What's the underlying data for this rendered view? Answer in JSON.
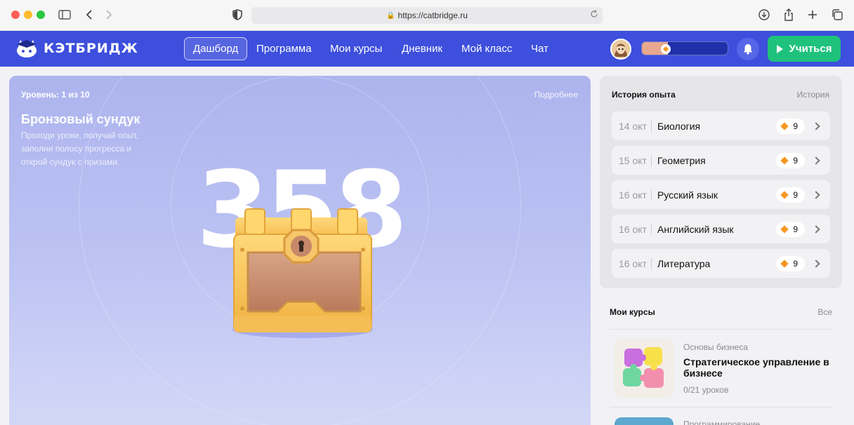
{
  "browser": {
    "url": "https://catbridge.ru"
  },
  "nav": {
    "logo_text": "КЭТБРИДЖ",
    "items": [
      {
        "label": "Дашборд",
        "active": true
      },
      {
        "label": "Программа"
      },
      {
        "label": "Мои курсы"
      },
      {
        "label": "Дневник"
      },
      {
        "label": "Мой класс"
      },
      {
        "label": "Чат"
      }
    ],
    "xp_progress": 0.3,
    "cta_label": "Учиться"
  },
  "hero": {
    "level": "Уровень: 1 из 10",
    "more_label": "Подробнее",
    "title": "Бронзовый сундук",
    "description": "Проходи уроки, получай опыт, заполни полосу прогресса и открой сундук с призами.",
    "points": "358"
  },
  "history": {
    "title": "История опыта",
    "link_label": "История",
    "rows": [
      {
        "date": "14 окт",
        "subject": "Биология",
        "points": "9"
      },
      {
        "date": "15 окт",
        "subject": "Геометрия",
        "points": "9"
      },
      {
        "date": "16 окт",
        "subject": "Русский язык",
        "points": "9"
      },
      {
        "date": "16 окт",
        "subject": "Английский язык",
        "points": "9"
      },
      {
        "date": "16 окт",
        "subject": "Литература",
        "points": "9"
      }
    ]
  },
  "courses": {
    "title": "Мои курсы",
    "all_label": "Все",
    "items": [
      {
        "category": "Основы бизнеса",
        "name": "Стратегическое управление в бизнесе",
        "progress": "0/21 уроков"
      },
      {
        "category": "Программирование"
      }
    ]
  },
  "colors": {
    "nav_bg": "#3d4fdc",
    "cta": "#1ec27c",
    "accent_diamond": "#f59722"
  }
}
